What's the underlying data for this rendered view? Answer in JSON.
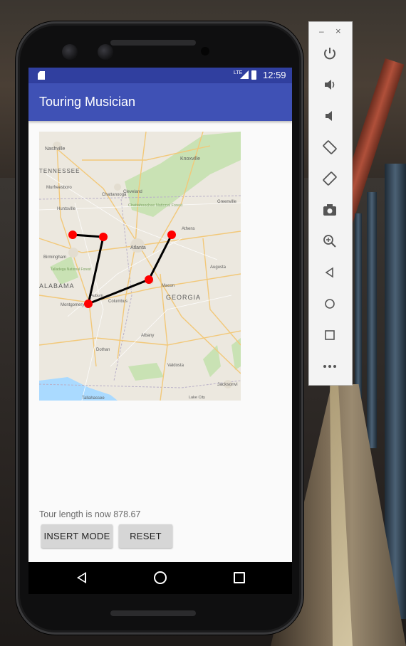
{
  "app": {
    "title": "Touring Musician"
  },
  "statusbar": {
    "time": "12:59",
    "network": "LTE"
  },
  "map": {
    "labels": [
      {
        "text": "Nashville"
      },
      {
        "text": "TENNESSEE"
      },
      {
        "text": "Murfreesboro"
      },
      {
        "text": "Knoxville"
      },
      {
        "text": "Chattanooga"
      },
      {
        "text": "Cleveland"
      },
      {
        "text": "Huntsville"
      },
      {
        "text": "Chattahoochee National Forest"
      },
      {
        "text": "Atlanta"
      },
      {
        "text": "Birmingham"
      },
      {
        "text": "Talladega National Forest"
      },
      {
        "text": "ALABAMA"
      },
      {
        "text": "Montgomery"
      },
      {
        "text": "Auburn"
      },
      {
        "text": "Columbus"
      },
      {
        "text": "GEORGIA"
      },
      {
        "text": "Macon"
      },
      {
        "text": "Augusta"
      },
      {
        "text": "Athens"
      },
      {
        "text": "Greenville"
      },
      {
        "text": "Dothan"
      },
      {
        "text": "Albany"
      },
      {
        "text": "Valdosta"
      },
      {
        "text": "Tallahassee"
      },
      {
        "text": "Jacksonvi"
      },
      {
        "text": "Lake City"
      }
    ],
    "tour_points": 5
  },
  "status": {
    "tour_length": "Tour length is now 878.67"
  },
  "buttons": {
    "insert_mode": "INSERT MODE",
    "reset": "RESET"
  },
  "nav": {
    "back_icon": "back-triangle-icon",
    "home_icon": "home-circle-icon",
    "recent_icon": "recent-square-icon"
  },
  "emulator_toolbar": {
    "minimize": "–",
    "close": "×",
    "tools": [
      {
        "name": "power-icon",
        "glyph": "⏻"
      },
      {
        "name": "volume-up-icon",
        "glyph": "🔊"
      },
      {
        "name": "volume-down-icon",
        "glyph": "🔉"
      },
      {
        "name": "rotate-left-icon",
        "glyph": "⟲"
      },
      {
        "name": "rotate-right-icon",
        "glyph": "⟳"
      },
      {
        "name": "camera-icon",
        "glyph": "📷"
      },
      {
        "name": "zoom-icon",
        "glyph": "⊕"
      },
      {
        "name": "back-icon",
        "glyph": "◁"
      },
      {
        "name": "home-icon",
        "glyph": "○"
      },
      {
        "name": "overview-icon",
        "glyph": "□"
      },
      {
        "name": "more-icon",
        "glyph": "•••"
      }
    ]
  },
  "colors": {
    "statusbar": "#303f9f",
    "appbar": "#3f51b5",
    "tour_point": "#ff0000",
    "tour_line": "#000000"
  }
}
